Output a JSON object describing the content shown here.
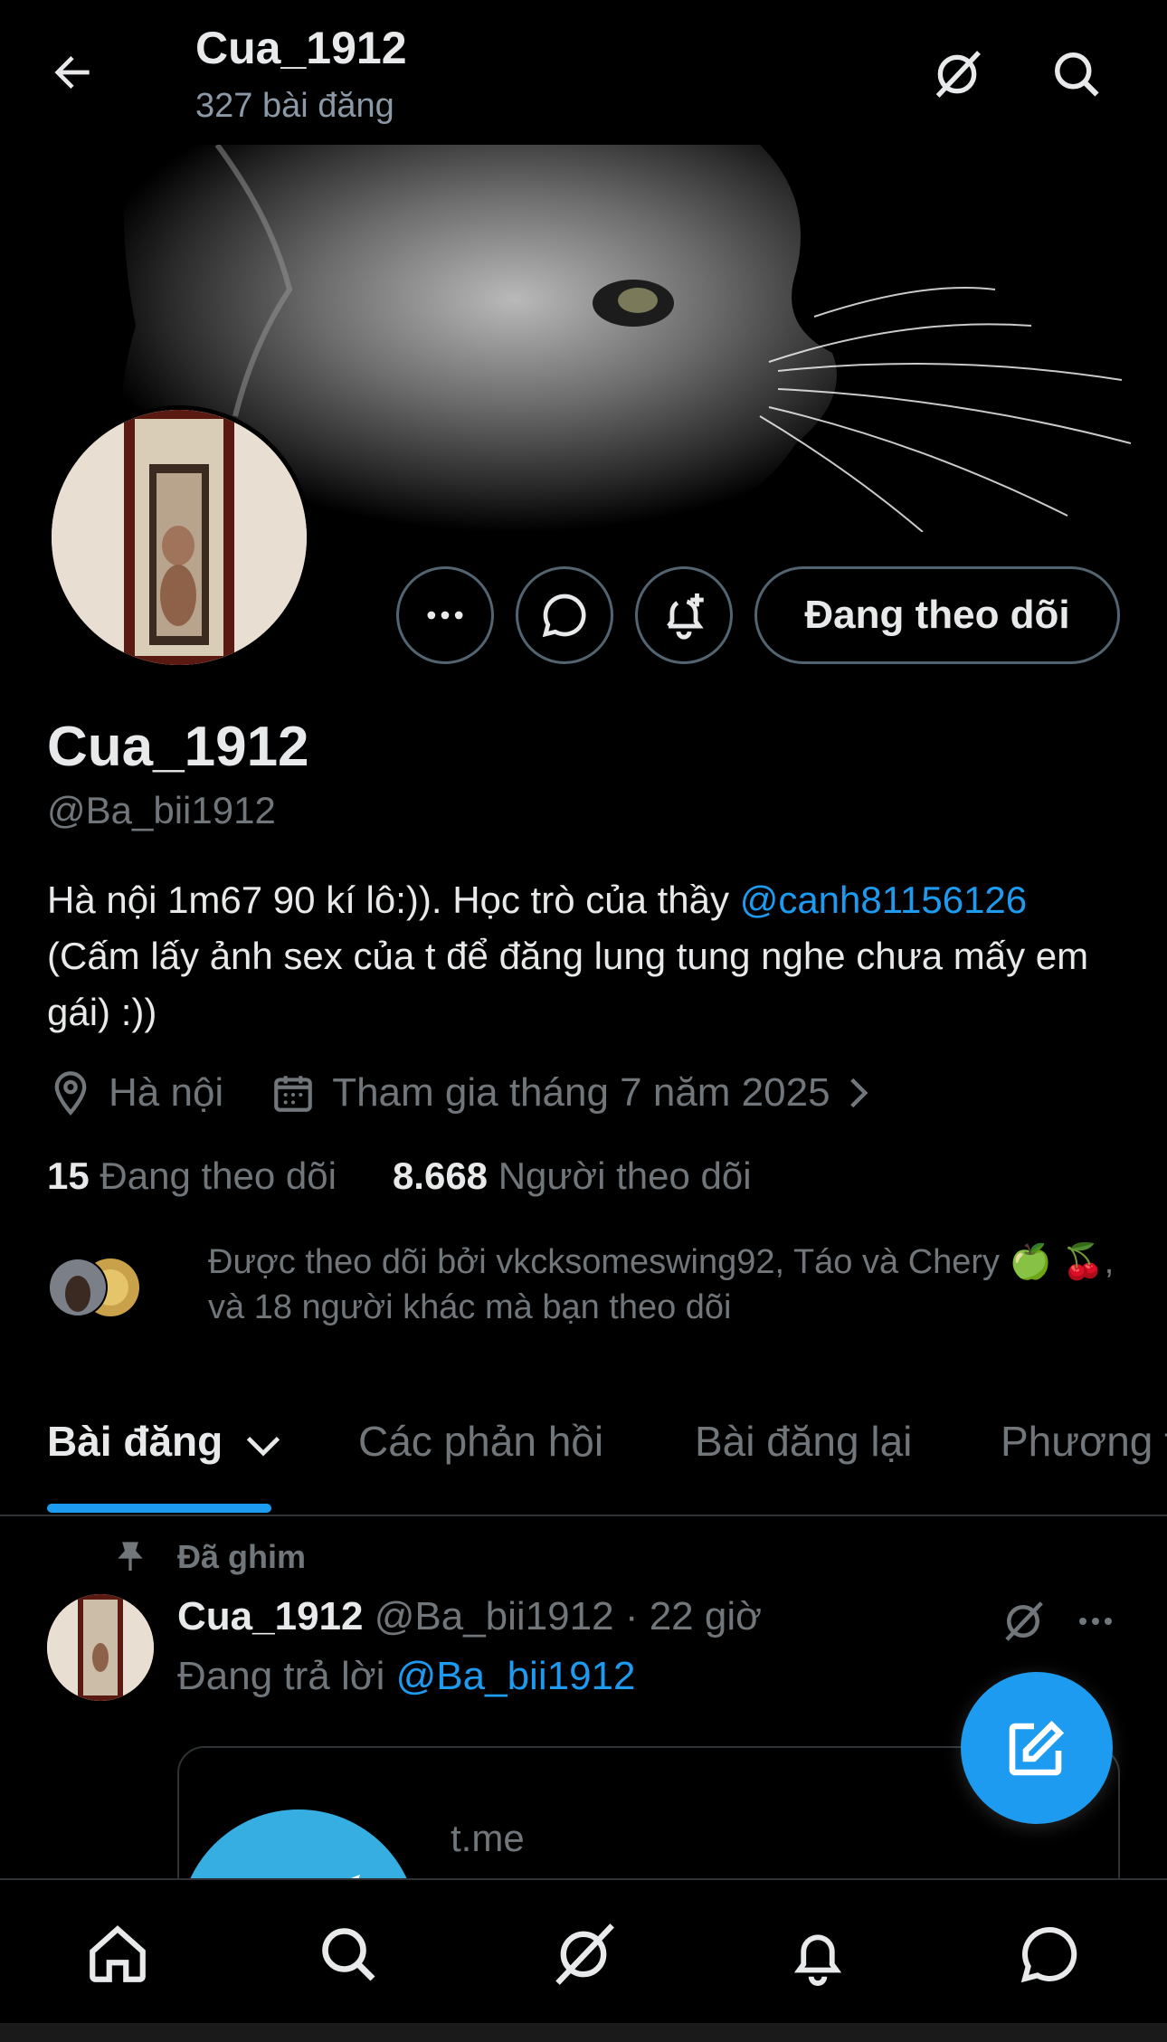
{
  "header": {
    "title": "Cua_1912",
    "post_count": "327 bài đăng"
  },
  "profile": {
    "display_name": "Cua_1912",
    "handle": "@Ba_bii1912",
    "follow_button": "Đang theo dõi",
    "bio_text": "Hà nội 1m67 90 kí lô:)). Học trò của thầy ",
    "bio_link": "@canh81156126",
    "bio_text_2": "(Cấm lấy ảnh sex của t để đăng lung tung nghe chưa mấy em gái) :))",
    "location": "Hà nội",
    "joined": "Tham gia tháng 7 năm 2025",
    "following_count": "15",
    "following_label": "Đang theo dõi",
    "followers_count": "8.668",
    "followers_label": "Người theo dõi",
    "followed_by_text": "Được theo dõi bởi vkcksomeswing92, Táo và Chery 🍏 🍒, và 18 người khác mà bạn theo dõi"
  },
  "tabs": [
    {
      "label": "Bài đăng"
    },
    {
      "label": "Các phản hồi"
    },
    {
      "label": "Bài đăng lại"
    },
    {
      "label": "Phương t"
    }
  ],
  "post": {
    "pinned_label": "Đã ghim",
    "author_name": "Cua_1912",
    "author_handle": "@Ba_bii1912",
    "time": "· 22 giờ",
    "reply_prefix": "Đang trả lời ",
    "reply_to": "@Ba_bii1912",
    "card_domain": "t.me"
  },
  "colors": {
    "accent": "#1d9bf0",
    "background": "#000000",
    "text_primary": "#e7e9ea",
    "text_secondary": "#71767b",
    "border": "#2f3336"
  },
  "icons": {
    "back": "arrow-left-icon",
    "grok": "grok-icon",
    "search": "search-icon",
    "more": "more-icon",
    "message": "message-icon",
    "notify": "bell-plus-icon",
    "location": "location-pin-icon",
    "calendar": "calendar-icon",
    "pin": "pin-icon",
    "compose": "compose-icon",
    "home": "home-icon",
    "notifications": "bell-icon",
    "messages": "chat-icon"
  }
}
